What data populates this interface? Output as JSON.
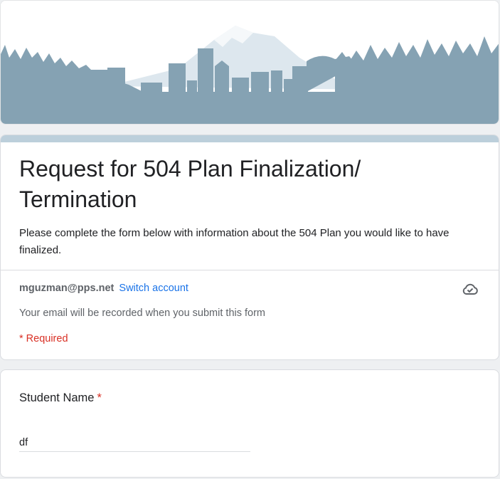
{
  "form": {
    "title": "Request for 504 Plan Finalization/ Termination",
    "description": "Please complete the form below with information about the 504 Plan you would like to have finalized.",
    "accent_color": "#bccfdb"
  },
  "account": {
    "email": "mguzman@pps.net",
    "switch_label": "Switch account",
    "status_icon": "cloud-saved-icon",
    "notice": "Your email will be recorded when you submit this form"
  },
  "required_note": "* Required",
  "questions": [
    {
      "label": "Student Name",
      "required_mark": "*",
      "value": "df"
    }
  ],
  "colors": {
    "banner_skyline": "#85a2b3",
    "link": "#1a73e8",
    "required": "#d93025"
  }
}
